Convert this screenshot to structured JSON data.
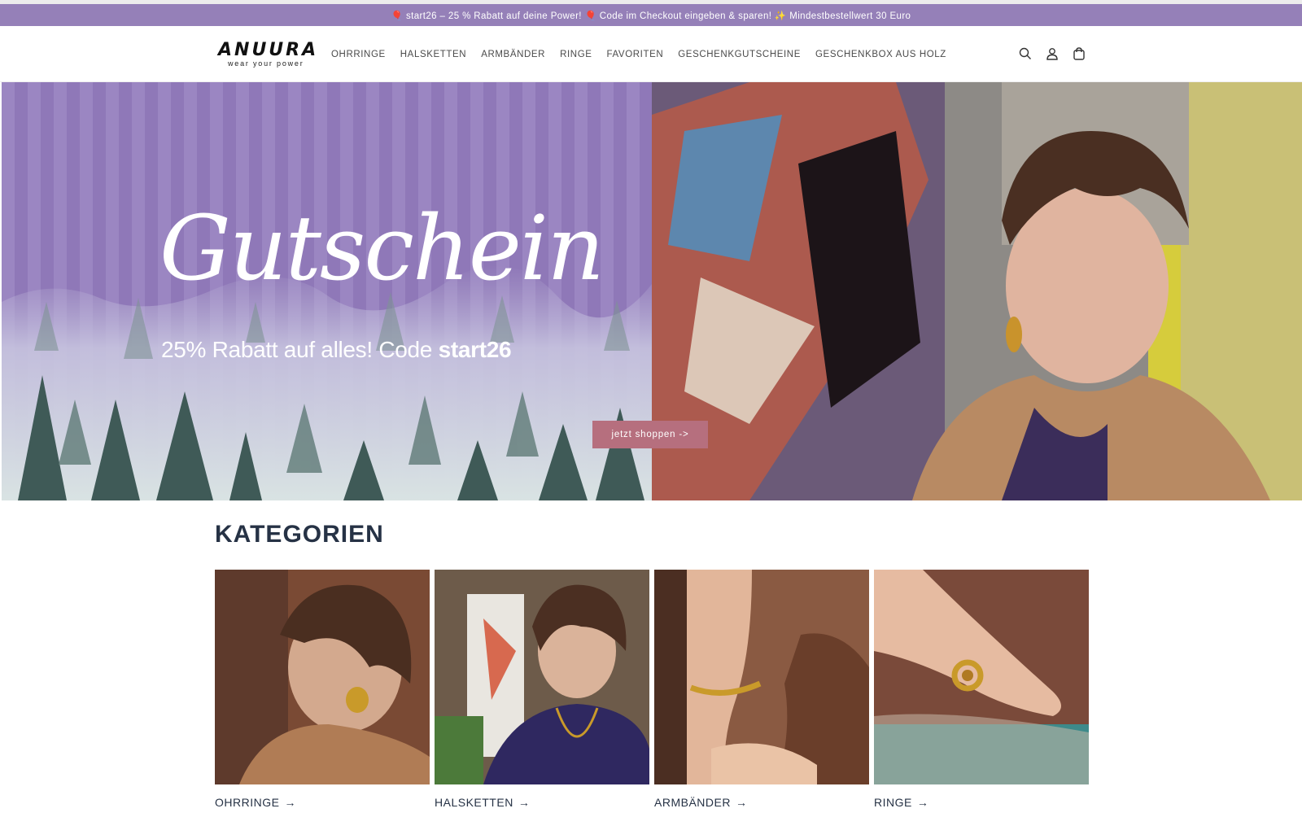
{
  "announcement": {
    "text": "🎈 start26 – 25 % Rabatt auf deine Power! 🎈 Code im Checkout eingeben & sparen! ✨ Mindestbestellwert 30 Euro"
  },
  "header": {
    "logo_word": "ANUURA",
    "logo_tagline": "wear your power",
    "nav": [
      {
        "label": "OHRRINGE"
      },
      {
        "label": "HALSKETTEN"
      },
      {
        "label": "ARMBÄNDER"
      },
      {
        "label": "RINGE"
      },
      {
        "label": "FAVORITEN"
      },
      {
        "label": "GESCHENKGUTSCHEINE"
      },
      {
        "label": "GESCHENKBOX AUS HOLZ"
      }
    ],
    "icons": [
      "search-icon",
      "account-icon",
      "cart-icon"
    ]
  },
  "hero": {
    "script_title": "Gutschein",
    "subtitle_prefix": "25% Rabatt auf alles! Code ",
    "subtitle_code": "start26",
    "button_label": "jetzt shoppen ->"
  },
  "categories": {
    "title": "KATEGORIEN",
    "items": [
      {
        "label": "OHRRINGE",
        "arrow": "→"
      },
      {
        "label": "HALSKETTEN",
        "arrow": "→"
      },
      {
        "label": "ARMBÄNDER",
        "arrow": "→"
      },
      {
        "label": "RINGE",
        "arrow": "→"
      }
    ]
  },
  "colors": {
    "announcement_bg": "#9580b8",
    "hero_purple": "#9b86c2",
    "button_bg": "#b66f7e",
    "heading_text": "#263245"
  }
}
